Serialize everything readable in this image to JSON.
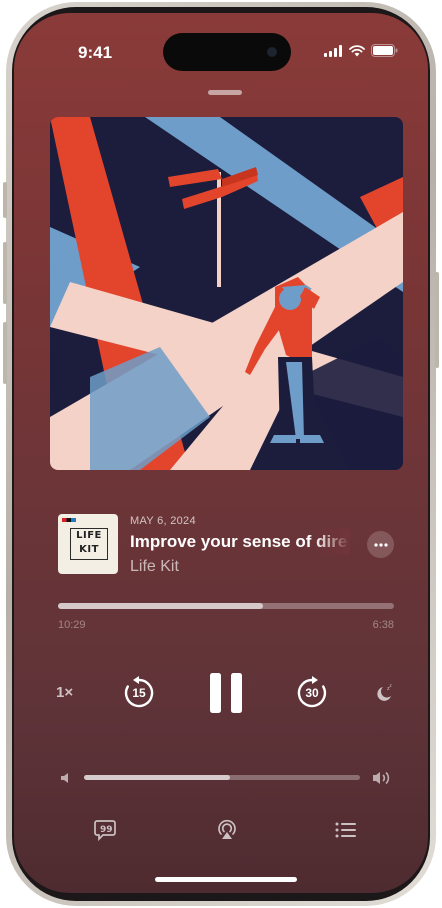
{
  "status_bar": {
    "time": "9:41"
  },
  "episode": {
    "date": "MAY 6, 2024",
    "title": "Improve your sense of direction",
    "show": "Life Kit",
    "thumb_line1": "LIFE",
    "thumb_line2": "KIT"
  },
  "playback": {
    "elapsed": "10:29",
    "remaining": "6:38",
    "progress_fraction": 0.61,
    "speed": "1×",
    "skip_back_seconds": "15",
    "skip_forward_seconds": "30",
    "state": "playing",
    "volume_fraction": 0.53
  },
  "icons": {
    "more": "ellipsis-icon",
    "pause": "pause-icon",
    "sleep_timer": "moon-icon",
    "volume_low": "speaker-low-icon",
    "volume_high": "speaker-high-icon",
    "transcript": "transcript-quote-icon",
    "airplay": "airplay-icon",
    "queue": "list-icon"
  },
  "colors": {
    "background_top": "#8a3b39",
    "background_bottom": "#4e2b30",
    "art_navy": "#1c1d3d",
    "art_red": "#e2452c",
    "art_blue": "#6d9dc8",
    "art_pink": "#f4d2c8"
  }
}
